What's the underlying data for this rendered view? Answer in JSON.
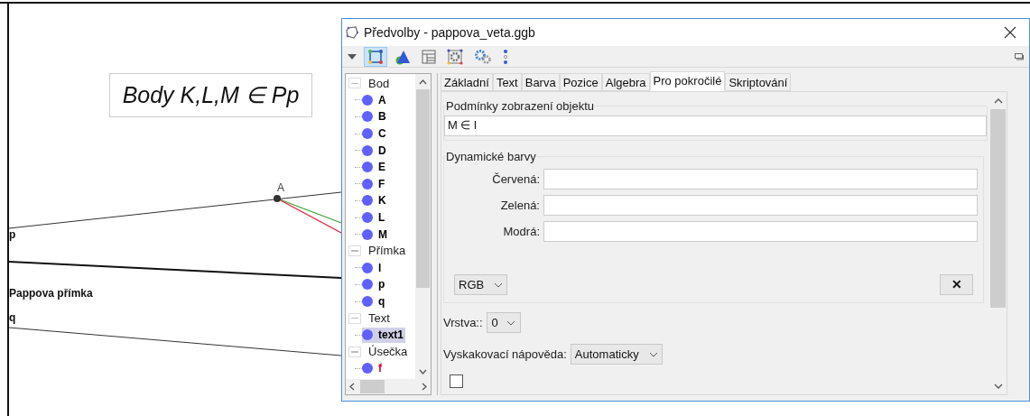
{
  "canvas": {
    "caption": "Body K,L,M ∈ Pp",
    "labels": [
      {
        "kind": "point",
        "text": "A"
      },
      {
        "kind": "line",
        "text": "p"
      },
      {
        "kind": "line",
        "text": "Pappova přímka"
      },
      {
        "kind": "line",
        "text": "q"
      }
    ]
  },
  "dialog": {
    "title": "Předvolby - pappova_veta.ggb",
    "toolbar": [
      {
        "kind": "menu",
        "selected": false
      },
      {
        "kind": "graphics",
        "selected": true
      },
      {
        "kind": "geometry",
        "selected": false
      },
      {
        "kind": "layout",
        "selected": false
      },
      {
        "kind": "defaults",
        "selected": false
      },
      {
        "kind": "advanced",
        "selected": false
      },
      {
        "kind": "more",
        "selected": false
      }
    ],
    "tree": [
      {
        "label": "Bod",
        "expanded": true,
        "children": [
          {
            "label": "A",
            "color": "#000000",
            "selected": false
          },
          {
            "label": "B",
            "color": "#000000",
            "selected": false
          },
          {
            "label": "C",
            "color": "#000000",
            "selected": false
          },
          {
            "label": "D",
            "color": "#000000",
            "selected": false
          },
          {
            "label": "E",
            "color": "#000000",
            "selected": false
          },
          {
            "label": "F",
            "color": "#000000",
            "selected": false
          },
          {
            "label": "K",
            "color": "#000000",
            "selected": false
          },
          {
            "label": "L",
            "color": "#000000",
            "selected": false
          },
          {
            "label": "M",
            "color": "#000000",
            "selected": false
          }
        ]
      },
      {
        "label": "Přímka",
        "expanded": true,
        "children": [
          {
            "label": "l",
            "color": "#000000",
            "selected": false
          },
          {
            "label": "p",
            "color": "#000000",
            "selected": false
          },
          {
            "label": "q",
            "color": "#000000",
            "selected": false
          }
        ]
      },
      {
        "label": "Text",
        "expanded": true,
        "children": [
          {
            "label": "text1",
            "color": "#000000",
            "selected": true
          }
        ]
      },
      {
        "label": "Úsečka",
        "expanded": true,
        "children": [
          {
            "label": "f",
            "color": "#e0002a",
            "selected": false
          }
        ]
      }
    ],
    "tabs": [
      {
        "label": "Základní",
        "selected": false
      },
      {
        "label": "Text",
        "selected": false
      },
      {
        "label": "Barva",
        "selected": false
      },
      {
        "label": "Pozice",
        "selected": false
      },
      {
        "label": "Algebra",
        "selected": false
      },
      {
        "label": "Pro pokročilé",
        "selected": true
      },
      {
        "label": "Skriptování",
        "selected": false
      }
    ],
    "condition": {
      "title": "Podmínky zobrazení objektu",
      "value": "M ∈ l"
    },
    "dynamic_colors": {
      "title": "Dynamické barvy",
      "fields": [
        {
          "label": "Červená:"
        },
        {
          "label": "Zelená:"
        },
        {
          "label": "Modrá:"
        }
      ],
      "mode": "RGB",
      "clear": "✕"
    },
    "layer": {
      "label": "Vrstva::",
      "value": "0"
    },
    "tooltip": {
      "label": "Vyskakovací nápověda:",
      "value": "Automaticky"
    },
    "checkbox": {
      "checked": false
    }
  }
}
